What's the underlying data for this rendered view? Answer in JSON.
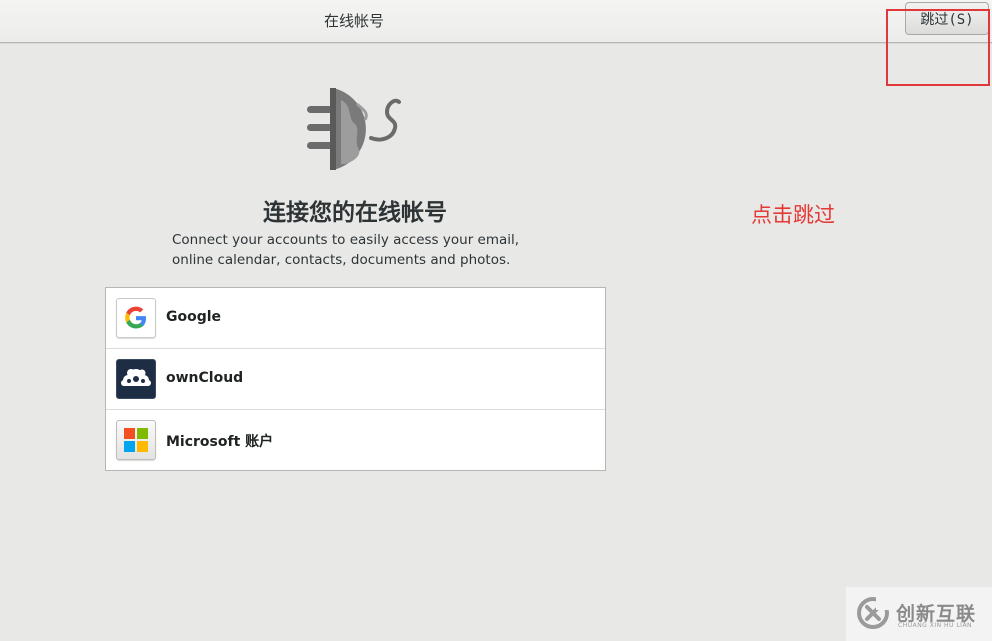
{
  "header": {
    "title": "在线帐号",
    "skip_label": "跳过(S)"
  },
  "main": {
    "logo_icon": "goa-plug-globe-icon",
    "title": "连接您的在线帐号",
    "description_line1": "Connect your accounts to easily access your email,",
    "description_line2": "online calendar, contacts, documents and photos."
  },
  "providers": [
    {
      "label": "Google",
      "icon": "google-icon"
    },
    {
      "label": "ownCloud",
      "icon": "owncloud-icon"
    },
    {
      "label": "Microsoft 账户",
      "icon": "microsoft-icon"
    }
  ],
  "annotation": {
    "text": "点击跳过",
    "color": "#e53935"
  },
  "watermark": {
    "text": "创新互联",
    "subtext": "CHUANG XIN HU LIAN"
  }
}
